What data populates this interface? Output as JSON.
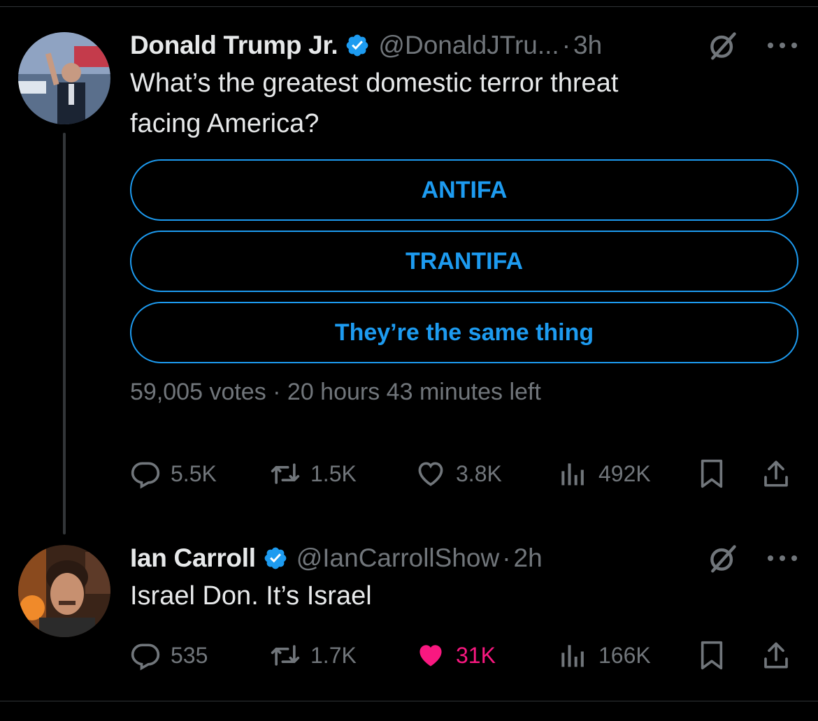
{
  "colors": {
    "accent": "#1d9bf0",
    "like": "#f91880",
    "muted": "#71767b",
    "text": "#e7e9ea",
    "background": "#000000"
  },
  "tweets": [
    {
      "name": "Donald Trump Jr.",
      "handle": "@DonaldJTru...",
      "dot": "·",
      "time": "3h",
      "text_lines": [
        "What’s the greatest domestic terror threat",
        "facing America?"
      ],
      "poll": {
        "options": [
          "ANTIFA",
          "TRANTIFA",
          "They’re the same thing"
        ],
        "meta": "59,005 votes · 20 hours 43 minutes left"
      },
      "stats": {
        "replies": "5.5K",
        "reposts": "1.5K",
        "likes": "3.8K",
        "views": "492K"
      }
    },
    {
      "name": "Ian Carroll",
      "handle": "@IanCarrollShow",
      "dot": "·",
      "time": "2h",
      "text_lines": [
        "Israel Don. It’s Israel"
      ],
      "stats": {
        "replies": "535",
        "reposts": "1.7K",
        "likes": "31K",
        "views": "166K"
      },
      "liked": true
    }
  ],
  "icons": [
    "verified-badge-icon",
    "grok-icon",
    "more-icon",
    "reply-icon",
    "repost-icon",
    "like-icon",
    "views-icon",
    "bookmark-icon",
    "share-icon"
  ]
}
